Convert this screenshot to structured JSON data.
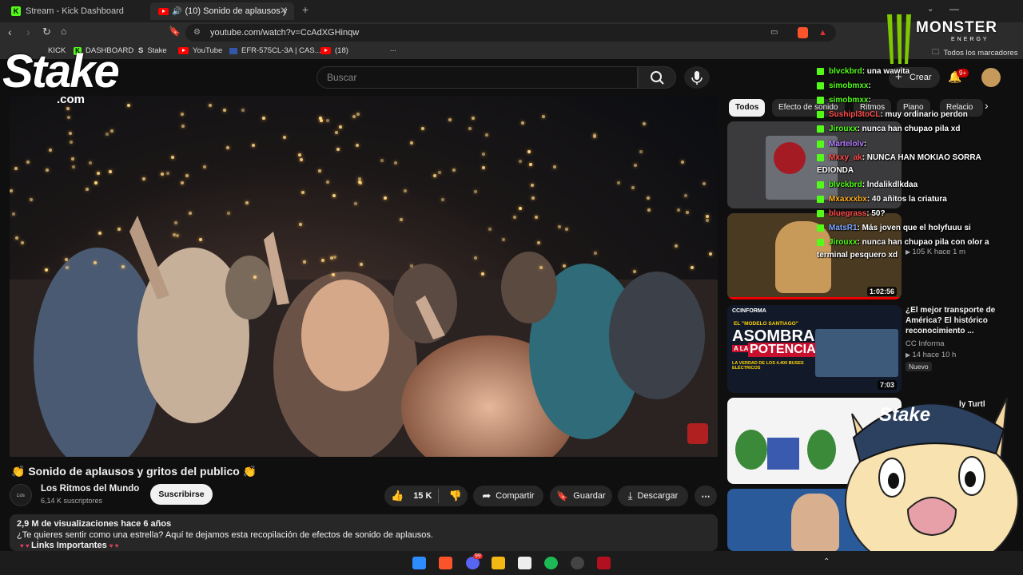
{
  "browser": {
    "tabs": [
      {
        "label": "Stream - Kick Dashboard",
        "icon": "kick-icon"
      },
      {
        "label": "(10) Sonido de aplausos y",
        "icon": "youtube-icon"
      }
    ],
    "new_tab": "+",
    "url": "youtube.com/watch?v=CcAdXGHinqw",
    "bookmarks": [
      "KICK",
      "DASHBOARD",
      "Stake",
      "YouTube",
      "EFR-575CL-3A | CAS...",
      "(18)",
      "..."
    ],
    "all_bookmarks": "Todos los marcadores"
  },
  "youtube": {
    "search_placeholder": "Buscar",
    "create_label": "Crear",
    "notif_count": "9+",
    "video": {
      "title": "Sonido de aplausos y gritos del publico",
      "title_emoji": "👏",
      "channel": "Los Ritmos del Mundo",
      "subscribers": "6,14 K suscriptores",
      "subscribe_label": "Suscribirse",
      "likes": "15 K",
      "share_label": "Compartir",
      "save_label": "Guardar",
      "download_label": "Descargar",
      "views_line": "2,9 M de visualizaciones  hace 6 años",
      "description": "¿Te quieres sentir como una estrella? Aquí te dejamos esta recopilación de efectos de sonido de aplausos.",
      "links_line": "Links Importantes"
    },
    "chips": [
      "Todos",
      "Efecto de sonido",
      "Ritmos",
      "Piano",
      "Relacio"
    ],
    "recommended": [
      {
        "duration": "",
        "views": "",
        "title": ""
      },
      {
        "duration": "1:02:56",
        "views": "105 K  hace 1 m"
      },
      {
        "duration": "7:03",
        "title": "¿El mejor transporte de América? El histórico reconocimiento ...",
        "channel": "CC Informa",
        "meta": "14  hace 10 h",
        "badge": "Nuevo",
        "thumb_brand": "CCINFORMA",
        "thumb_text1": "EL \"MODELO SANTIAGO\"",
        "thumb_text2": "ASOMBRA",
        "thumb_text3": "A LA",
        "thumb_text4": "POTENCIA",
        "thumb_text5": "LA VERDAD DE LOS 4.400 BUSES ELÉCTRICOS"
      },
      {
        "duration": "",
        "title_partial": "ly Turtl"
      }
    ]
  },
  "chat": [
    {
      "user": "blvckbrd",
      "msg": ": una wawita",
      "color": "#53fc18"
    },
    {
      "user": "simobmxx",
      "msg": ":",
      "color": "#53fc18"
    },
    {
      "user": "simobmxx",
      "msg": ":",
      "color": "#53fc18"
    },
    {
      "user": "Sushipl3toCL",
      "msg": ": muy ordinario      perdon",
      "color": "#ff4d4d"
    },
    {
      "user": "Jirouxx",
      "msg": ": nunca han chupao pila xd",
      "color": "#53fc18"
    },
    {
      "user": "Martelolv",
      "msg": ":",
      "color": "#b37bff"
    },
    {
      "user": "Mxxy_ak",
      "msg": ": NUNCA HAN MOKIAO SORRA",
      "color": "#ff4d4d"
    },
    {
      "user": "",
      "msg": "EDIONDA",
      "color": "#ffffff"
    },
    {
      "user": "blvckbrd",
      "msg": ": lndalikdlkdaa",
      "color": "#53fc18"
    },
    {
      "user": "Mxaxxxbx",
      "msg": ": 40 añitos la criatura",
      "color": "#ffb020"
    },
    {
      "user": "bluegrass",
      "msg": ": 50?",
      "color": "#ff4d4d"
    },
    {
      "user": "MatsR1",
      "msg": ": Más joven que el holyfuuu si",
      "color": "#7aa7ff"
    },
    {
      "user": "Jirouxx",
      "msg": ": nunca han chupao pila con olor a",
      "color": "#53fc18"
    },
    {
      "user": "",
      "msg": "terminal pesquero xd",
      "color": "#ffffff"
    }
  ],
  "overlay": {
    "stake_logo": "Stake",
    "stake_sub": ".com",
    "monster_logo": "MONSTER",
    "monster_sub": "ENERGY",
    "cap_text": "Stake"
  },
  "taskbar": {
    "apps": [
      "windows-start",
      "brave",
      "discord",
      "file-explorer",
      "zoom",
      "spotify",
      "obs",
      "app-triangle"
    ],
    "discord_badge": "99"
  }
}
